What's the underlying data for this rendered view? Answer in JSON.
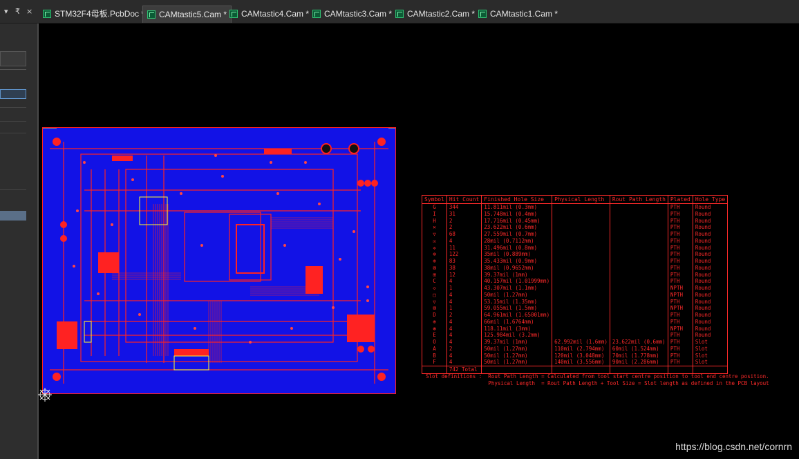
{
  "tabbar": {
    "controls": [
      "▾",
      "₹",
      "×"
    ],
    "tabs": [
      {
        "label": "STM32F4母板.PcbDoc *",
        "active": false,
        "icon": "pcbdoc-icon"
      },
      {
        "label": "CAMtastic5.Cam *",
        "active": true,
        "icon": "cam-icon"
      },
      {
        "label": "CAMtastic4.Cam *",
        "active": false,
        "icon": "cam-icon"
      },
      {
        "label": "CAMtastic3.Cam *",
        "active": false,
        "icon": "cam-icon"
      },
      {
        "label": "CAMtastic2.Cam *",
        "active": false,
        "icon": "cam-icon"
      },
      {
        "label": "CAMtastic1.Cam *",
        "active": false,
        "icon": "cam-icon"
      }
    ]
  },
  "drill_table": {
    "headers": [
      "Symbol",
      "Hit Count",
      "Finished Hole Size",
      "Physical Length",
      "Rout Path Length",
      "Plated",
      "Hole Type"
    ],
    "rows": [
      [
        "G",
        "344",
        "11.811mil (0.3mm)",
        "",
        "",
        "PTH",
        "Round"
      ],
      [
        "I",
        "31",
        "15.748mil (0.4mm)",
        "",
        "",
        "PTH",
        "Round"
      ],
      [
        "H",
        "2",
        "17.716mil (0.45mm)",
        "",
        "",
        "PTH",
        "Round"
      ],
      [
        "✕",
        "2",
        "23.622mil (0.6mm)",
        "",
        "",
        "PTH",
        "Round"
      ],
      [
        "▽",
        "68",
        "27.559mil (0.7mm)",
        "",
        "",
        "PTH",
        "Round"
      ],
      [
        "☒",
        "4",
        "28mil (0.7112mm)",
        "",
        "",
        "PTH",
        "Round"
      ],
      [
        "✲",
        "11",
        "31.496mil (0.8mm)",
        "",
        "",
        "PTH",
        "Round"
      ],
      [
        "⊗",
        "122",
        "35mil (0.889mm)",
        "",
        "",
        "PTH",
        "Round"
      ],
      [
        "⊕",
        "83",
        "35.433mil (0.9mm)",
        "",
        "",
        "PTH",
        "Round"
      ],
      [
        "⊠",
        "38",
        "38mil (0.9652mm)",
        "",
        "",
        "PTH",
        "Round"
      ],
      [
        "⊞",
        "12",
        "39.37mil (1mm)",
        "",
        "",
        "PTH",
        "Round"
      ],
      [
        "C",
        "4",
        "40.157mil (1.01999mm)",
        "",
        "",
        "PTH",
        "Round"
      ],
      [
        "◇",
        "1",
        "43.307mil (1.1mm)",
        "",
        "",
        "NPTH",
        "Round"
      ],
      [
        "□",
        "4",
        "50mil (1.27mm)",
        "",
        "",
        "NPTH",
        "Round"
      ],
      [
        "▽",
        "4",
        "53.15mil (1.35mm)",
        "",
        "",
        "PTH",
        "Round"
      ],
      [
        "⊠",
        "1",
        "59.055mil (1.5mm)",
        "",
        "",
        "NPTH",
        "Round"
      ],
      [
        "D",
        "2",
        "64.961mil (1.65001mm)",
        "",
        "",
        "PTH",
        "Round"
      ],
      [
        "⊕",
        "4",
        "66mil (1.6764mm)",
        "",
        "",
        "PTH",
        "Round"
      ],
      [
        "⊛",
        "4",
        "118.11mil (3mm)",
        "",
        "",
        "NPTH",
        "Round"
      ],
      [
        "E",
        "4",
        "125.984mil (3.2mm)",
        "",
        "",
        "PTH",
        "Round"
      ],
      [
        "O",
        "4",
        "39.37mil (1mm)",
        "62.992mil (1.6mm)",
        "23.622mil (0.6mm)",
        "PTH",
        "Slot"
      ],
      [
        "A",
        "2",
        "50mil (1.27mm)",
        "110mil (2.794mm)",
        "60mil (1.524mm)",
        "PTH",
        "Slot"
      ],
      [
        "B",
        "4",
        "50mil (1.27mm)",
        "120mil (3.048mm)",
        "70mil (1.778mm)",
        "PTH",
        "Slot"
      ],
      [
        "F",
        "4",
        "50mil (1.27mm)",
        "140mil (3.556mm)",
        "90mil (2.286mm)",
        "PTH",
        "Slot"
      ]
    ],
    "total_count": "742",
    "total_label": "Total"
  },
  "slot_definitions": {
    "line1": "Slot definitions :  Rout Path Length = Calculated from tool start centre position to tool end centre position.",
    "line2": "                    Physical Length  = Rout Path Length + Tool Size = Slot length as defined in the PCB layout"
  },
  "watermark": "https://blog.csdn.net/cornrn",
  "colors": {
    "board_fill": "#1212e6",
    "copper": "#ff2222",
    "silk": "#ffff33",
    "drill_text": "#ff2a2a",
    "background": "#000000"
  }
}
